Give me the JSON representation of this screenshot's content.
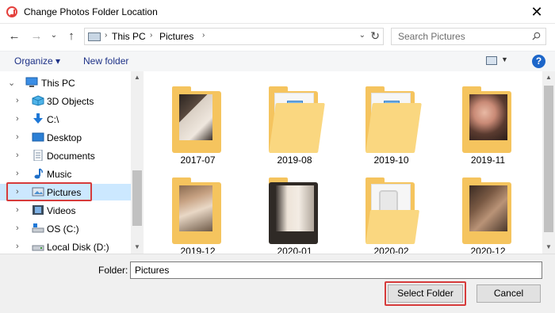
{
  "window": {
    "title": "Change Photos Folder Location",
    "close_glyph": "✕"
  },
  "nav": {
    "back_glyph": "←",
    "forward_glyph": "→",
    "recent_glyph": "⌄",
    "up_glyph": "↑",
    "address": {
      "crumbs": [
        "This PC",
        "Pictures"
      ],
      "separator": "›",
      "dropdown_glyph": "⌄",
      "refresh_glyph": "↻"
    },
    "search_placeholder": "Search Pictures"
  },
  "toolbar": {
    "organize_label": "Organize ▾",
    "new_folder_label": "New folder",
    "view_dropdown_glyph": "▼",
    "help_glyph": "?"
  },
  "sidebar": {
    "items": [
      {
        "label": "This PC",
        "icon": "computer-icon",
        "expanded": true
      },
      {
        "label": "3D Objects",
        "icon": "cube-3d-icon"
      },
      {
        "label": "C:\\",
        "icon": "download-arrow-icon"
      },
      {
        "label": "Desktop",
        "icon": "desktop-icon"
      },
      {
        "label": "Documents",
        "icon": "documents-icon"
      },
      {
        "label": "Music",
        "icon": "music-note-icon"
      },
      {
        "label": "Pictures",
        "icon": "pictures-icon",
        "selected": true
      },
      {
        "label": "Videos",
        "icon": "videos-icon"
      },
      {
        "label": "OS (C:)",
        "icon": "os-drive-icon"
      },
      {
        "label": "Local Disk (D:)",
        "icon": "drive-icon"
      }
    ],
    "expand_glyph": "⌄",
    "collapse_glyph": "›"
  },
  "folders": [
    {
      "name": "2017-07",
      "thumb": "photo"
    },
    {
      "name": "2019-08",
      "thumb": "image-icon"
    },
    {
      "name": "2019-10",
      "thumb": "image-icon"
    },
    {
      "name": "2019-11",
      "thumb": "photo"
    },
    {
      "name": "2019-12",
      "thumb": "photo"
    },
    {
      "name": "2020-01",
      "thumb": "photo"
    },
    {
      "name": "2020-02",
      "thumb": "phone-photo"
    },
    {
      "name": "2020-12",
      "thumb": "photo"
    }
  ],
  "footer": {
    "folder_label": "Folder:",
    "folder_value": "Pictures",
    "select_button": "Select Folder",
    "cancel_button": "Cancel"
  },
  "colors": {
    "accent_highlight": "#d63b3b",
    "selection_bg": "#cce8ff",
    "folder_yellow": "#f5c45e"
  }
}
